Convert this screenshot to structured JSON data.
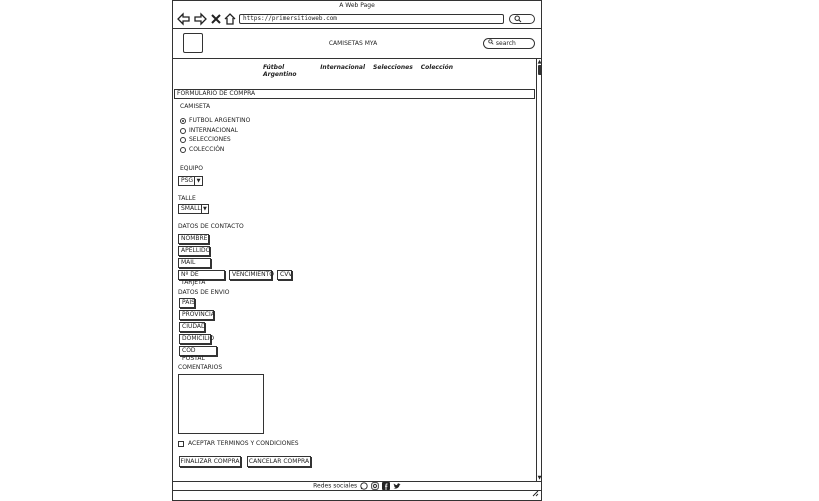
{
  "window": {
    "title": "A Web Page"
  },
  "browser": {
    "url": "https://primersitioweb.com",
    "back_icon": "back-arrow-icon",
    "forward_icon": "forward-arrow-icon",
    "close_icon": "close-icon",
    "home_icon": "home-icon",
    "search_icon": "search-icon"
  },
  "header": {
    "title": "CAMISETAS MYA",
    "search_placeholder": "search"
  },
  "menu": {
    "items": [
      "Fútbol Argentino",
      "Internacional",
      "Selecciones",
      "Colección"
    ]
  },
  "form": {
    "title": "FORMULARIO DE COMPRA",
    "camiseta_label": "CAMISETA",
    "options": [
      {
        "label": "FUTBOL ARGENTINO",
        "selected": true
      },
      {
        "label": "INTERNACIONAL",
        "selected": false
      },
      {
        "label": "SELECCIONES",
        "selected": false
      },
      {
        "label": "COLECCIÓN",
        "selected": false
      }
    ],
    "equipo_label": "EQUIPO",
    "equipo_value": "PSG",
    "talle_label": "TALLE",
    "talle_value": "SMALL",
    "contacto_label": "DATOS DE CONTACTO",
    "nombre": "NOMBRE",
    "apellido": "APELLIDO",
    "mail": "MAIL",
    "tarjeta": "Nº DE TARJETA",
    "vencimiento": "VENCIMIENTO",
    "cvv": "CVV",
    "envio_label": "DATOS DE ENVIO",
    "pais": "PAIS",
    "provincia": "PROVINCIA",
    "ciudad": "CIUDAD",
    "domicilio": "DOMICILIO",
    "cod_postal": "COD POSTAL",
    "comentarios_label": "COMENTARIOS",
    "terminos": "ACEPTAR TERMINOS Y CONDICIONES",
    "finalizar": "FINALIZAR COMPRA",
    "cancelar": "CANCELAR COMPRA"
  },
  "footer": {
    "label": "Redes sociales",
    "icons": [
      "whatsapp-icon",
      "instagram-icon",
      "facebook-icon",
      "twitter-icon"
    ]
  }
}
